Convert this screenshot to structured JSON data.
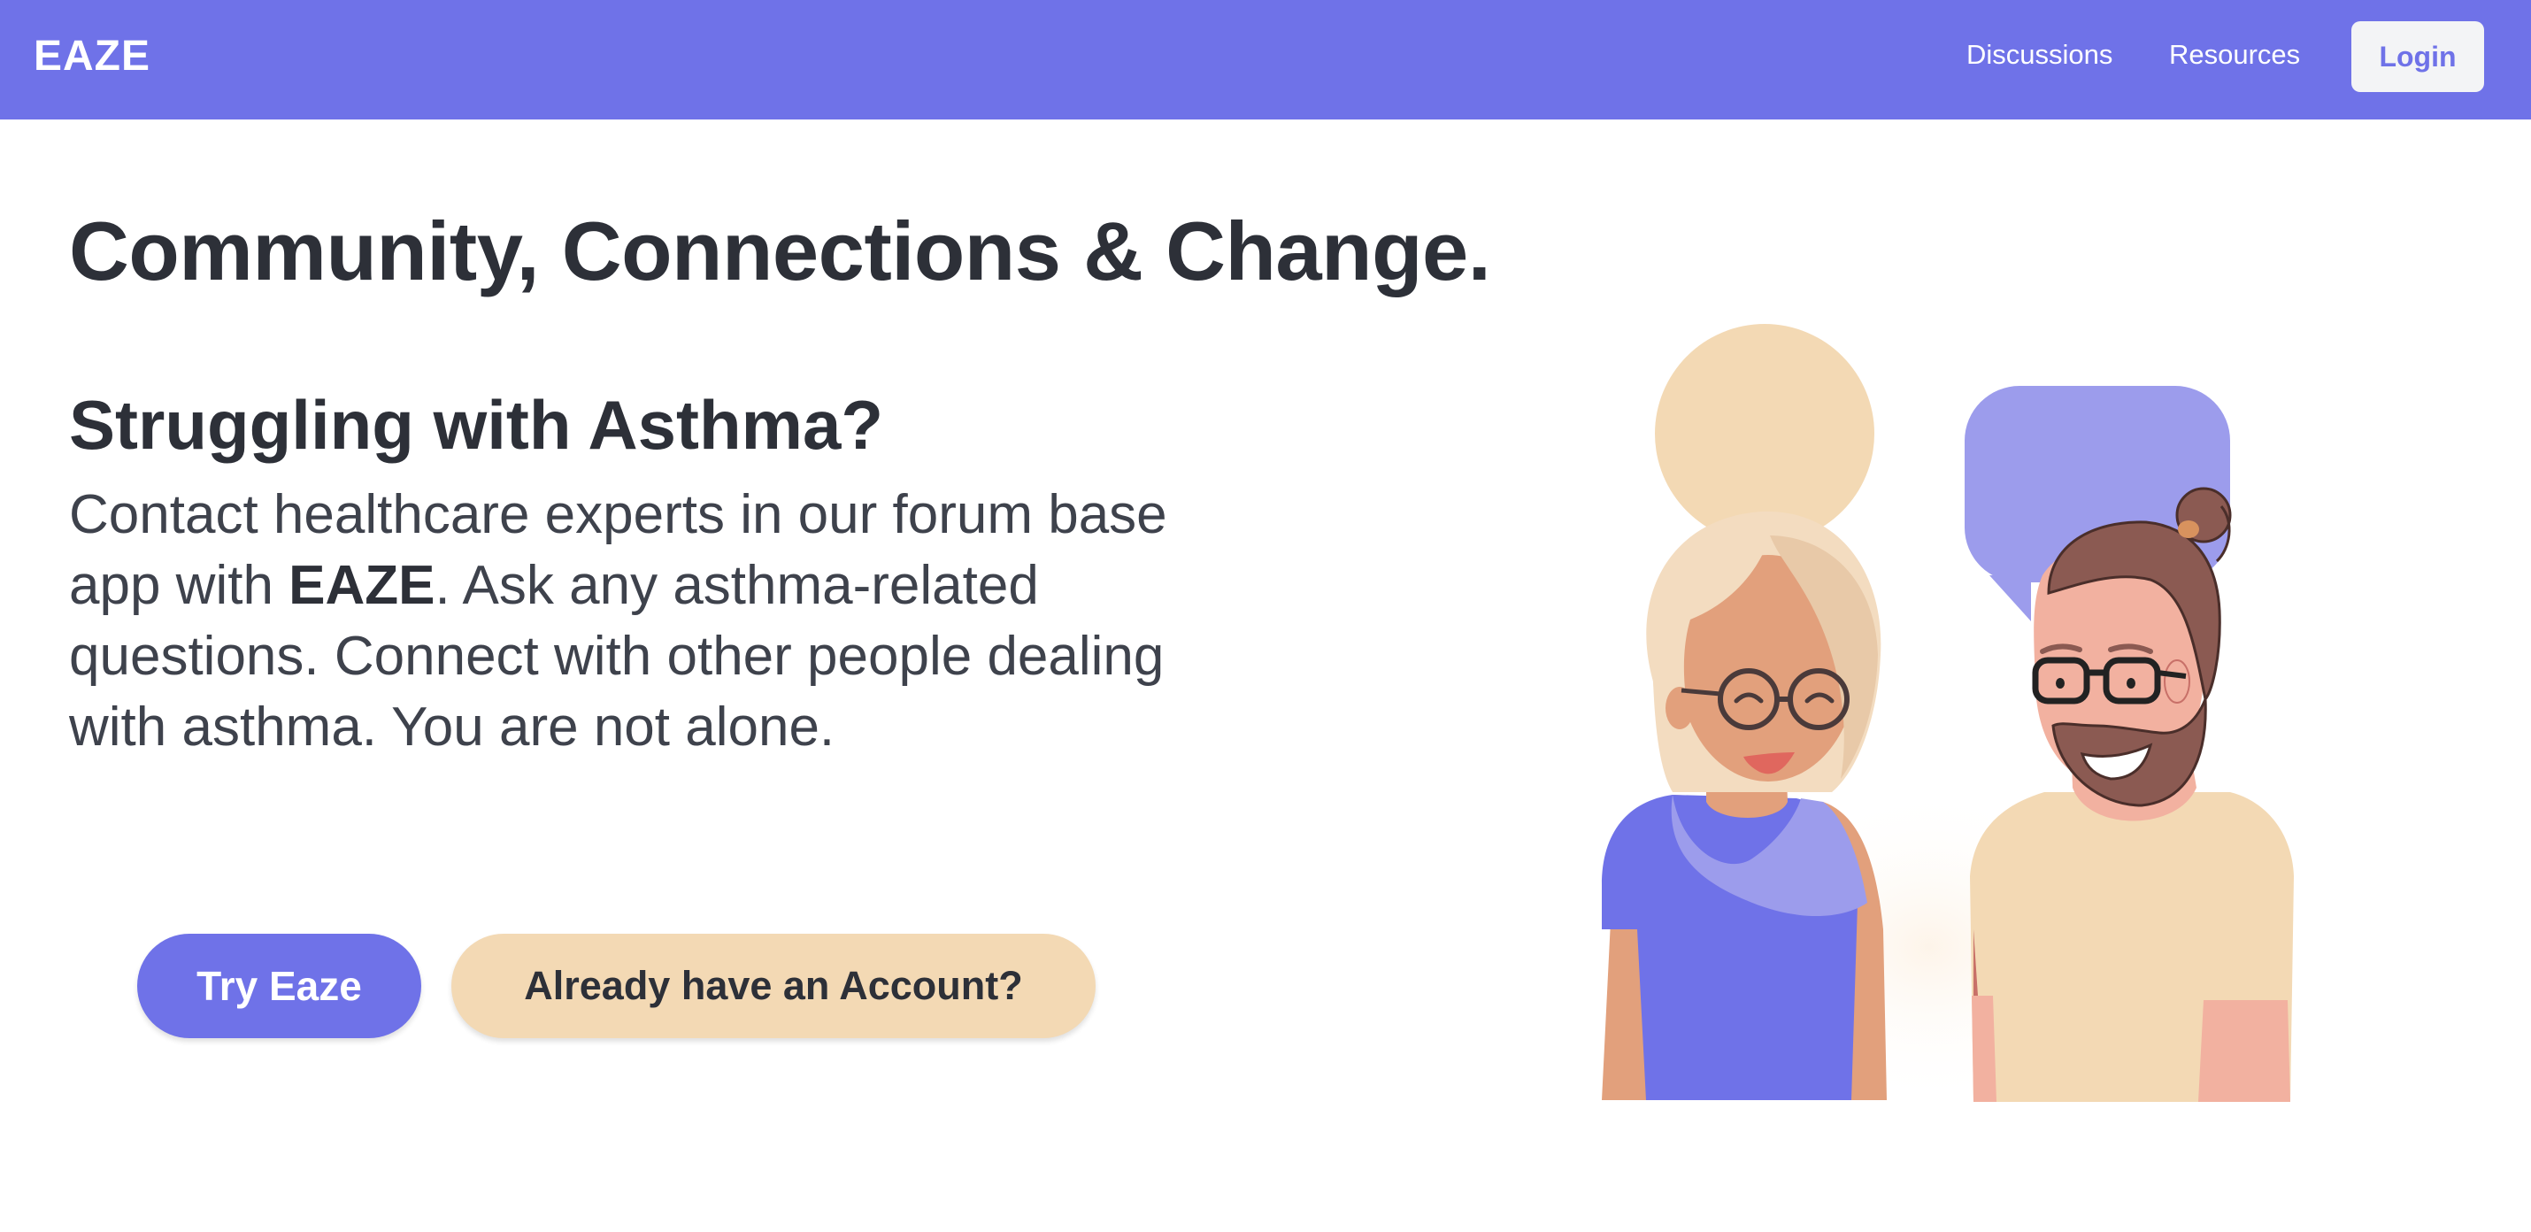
{
  "navbar": {
    "brand": "EAZE",
    "links": [
      "Discussions",
      "Resources"
    ],
    "login_label": "Login"
  },
  "hero": {
    "headline": "Community, Connections & Change.",
    "subheadline": "Struggling with Asthma?",
    "body_before": "Contact healthcare experts in our forum base app with ",
    "body_brand": "EAZE",
    "body_after": ". Ask any asthma-related questions. Connect with other people dealing with asthma. You are not alone.",
    "primary_cta": "Try Eaze",
    "secondary_cta": "Already have an Account?"
  },
  "illustration": {
    "icon": "two-people-chatting-illustration",
    "colors": {
      "accent": "#6f72e8",
      "accent_light": "#9c9cec",
      "cream": "#f3d9b4",
      "skin_woman": "#e2a07c",
      "skin_man": "#f2b1a0",
      "hair_woman": "#f3dcc0",
      "hair_man": "#8b5a52"
    }
  }
}
